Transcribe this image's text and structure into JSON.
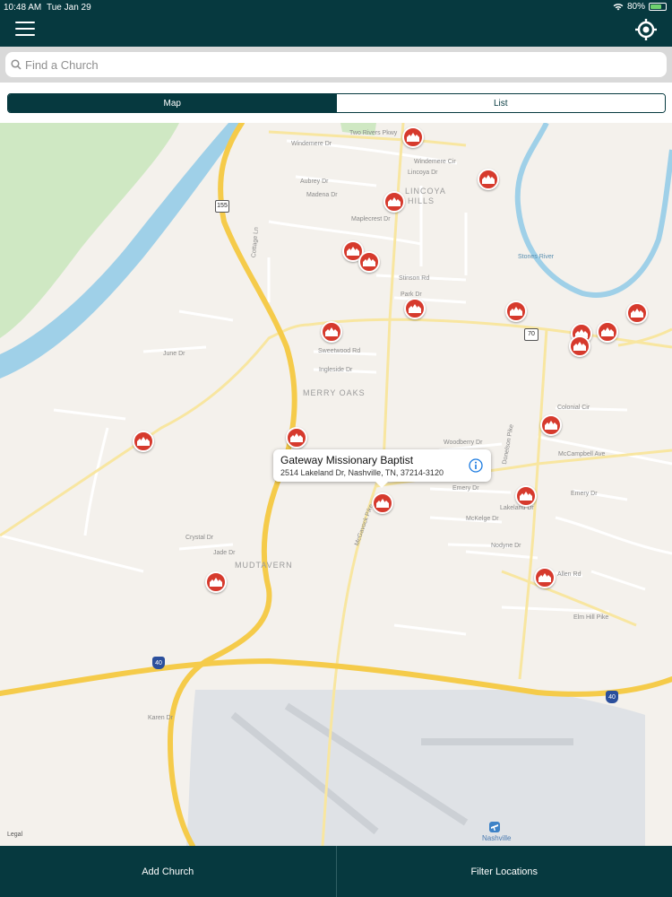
{
  "status": {
    "time": "10:48 AM",
    "date": "Tue Jan 29",
    "battery": "80%",
    "battery_level": 0.8
  },
  "search": {
    "placeholder": "Find a Church"
  },
  "segments": {
    "map": "Map",
    "list": "List"
  },
  "map": {
    "areas": {
      "lincoya": "LINCOYA",
      "hills": "HILLS",
      "merry_oaks": "MERRY OAKS",
      "mudtavern": "MUDTAVERN"
    },
    "streets": {
      "two_rivers": "Two Rivers Pkwy",
      "windemere": "Windemere Dr",
      "windemere2": "Windemere Cir",
      "aubrey": "Aubrey Dr",
      "madena": "Madena Dr",
      "lincoya": "Lincoya Dr",
      "maplecrest": "Maplecrest Dr",
      "stinson": "Stinson Rd",
      "park": "Park Dr",
      "sweetwood": "Sweetwood Rd",
      "ingleside": "Ingleside Dr",
      "june": "June Dr",
      "colonial": "Colonial Cir",
      "woodberry": "Woodberry Dr",
      "emery": "Emery Dr",
      "lakeland": "Lakeland Dr",
      "mckelge": "McKelge Dr",
      "nodyne": "Nodyne Dr",
      "allen": "Allen Rd",
      "elm_hill": "Elm Hill Pike",
      "donelson": "Donelson Pike",
      "mcgavock": "McGavock Pike",
      "karen": "Karen Dr",
      "crystal": "Crystal Dr",
      "jade": "Jade Dr",
      "cottage": "Cottage Ln",
      "stones_river": "Stones River",
      "nashville": "Nashville",
      "mcgampbell": "McCampbell Ave"
    },
    "shields": {
      "h155": "155",
      "h70": "70",
      "i40a": "40",
      "i40b": "40"
    },
    "legal": "Legal"
  },
  "callout": {
    "title": "Gateway Missionary Baptist",
    "address": "2514 Lakeland Dr, Nashville, TN, 37214-3120"
  },
  "bottom": {
    "add": "Add Church",
    "filter": "Filter Locations"
  },
  "colors": {
    "brand": "#06393f",
    "pin": "#d63a2d",
    "water": "#9fd0e8",
    "park": "#cfe8c3",
    "highway": "#f5cb4a"
  }
}
